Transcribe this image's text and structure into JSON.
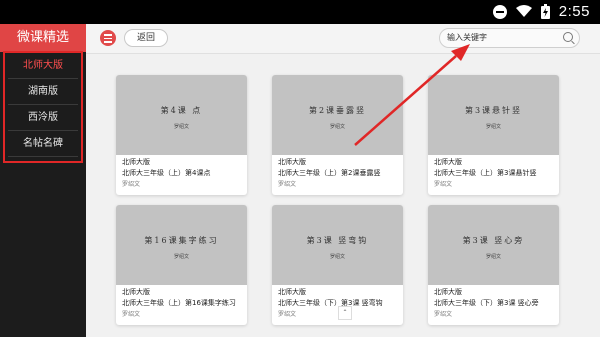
{
  "status": {
    "time": "2:55"
  },
  "sidebar": {
    "brand": "微课精选",
    "items": [
      {
        "label": "北师大版",
        "active": true
      },
      {
        "label": "湖南版"
      },
      {
        "label": "西泠版"
      },
      {
        "label": "名帖名碑"
      }
    ]
  },
  "topbar": {
    "back": "返回",
    "search_placeholder": "输入关键字"
  },
  "cards": [
    {
      "thumb_title": "第4课 点",
      "thumb_author": "罗绍文",
      "line1": "北师大版",
      "line2": "北师大三年级（上）第4课点",
      "author": "罗绍文"
    },
    {
      "thumb_title": "第2课垂露竖",
      "thumb_author": "罗绍文",
      "line1": "北师大版",
      "line2": "北师大三年级（上）第2课垂露竖",
      "author": "罗绍文"
    },
    {
      "thumb_title": "第3课悬针竖",
      "thumb_author": "罗绍文",
      "line1": "北师大版",
      "line2": "北师大三年级（上）第3课悬针竖",
      "author": "罗绍文"
    },
    {
      "thumb_title": "第16课集字练习",
      "thumb_author": "罗绍文",
      "line1": "北师大版",
      "line2": "北师大三年级（上）第16课集字练习",
      "author": "罗绍文"
    },
    {
      "thumb_title": "第3课 竖弯钩",
      "thumb_author": "罗绍文",
      "line1": "北师大版",
      "line2": "北师大三年级（下）第3课 竖弯钩",
      "author": "罗绍文"
    },
    {
      "thumb_title": "第3课 竖心旁",
      "thumb_author": "罗绍文",
      "line1": "北师大版",
      "line2": "北师大三年级（下）第3课 竖心旁",
      "author": "罗绍文"
    }
  ],
  "colors": {
    "accent": "#e04545",
    "highlight": "#e02727"
  },
  "icons": [
    "do-not-disturb-icon",
    "wifi-icon",
    "battery-icon",
    "list-icon",
    "search-icon"
  ]
}
